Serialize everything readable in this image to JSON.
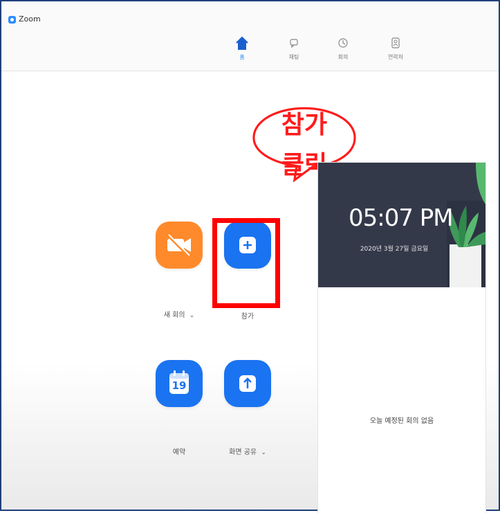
{
  "window": {
    "title": "Zoom"
  },
  "nav": {
    "tabs": [
      {
        "label": "홈",
        "icon": "home-icon",
        "active": true
      },
      {
        "label": "채팅",
        "icon": "chat-icon",
        "active": false
      },
      {
        "label": "회의",
        "icon": "clock-icon",
        "active": false
      },
      {
        "label": "연락처",
        "icon": "contacts-icon",
        "active": false
      }
    ]
  },
  "callout": {
    "line1": "참가",
    "line2": "클릭"
  },
  "actions": {
    "new_meeting": {
      "label": "새 회의",
      "chevron": "⌄",
      "icon": "video-off-icon",
      "color": "#ff8a2b"
    },
    "join": {
      "label": "참가",
      "icon": "plus-icon",
      "color": "#1a73f0"
    },
    "schedule": {
      "label": "예약",
      "icon": "calendar-icon",
      "calendar_day": "19",
      "color": "#1a73f0"
    },
    "share_screen": {
      "label": "화면 공유",
      "chevron": "⌄",
      "icon": "share-up-arrow-icon",
      "color": "#1a73f0"
    }
  },
  "schedule_panel": {
    "time": "05:07 PM",
    "date": "2020년 3월 27일 금요일",
    "empty_message": "오늘 예정된 회의 없음"
  },
  "colors": {
    "accent": "#2d8cff",
    "highlight": "#ff0000",
    "callout_text": "#ff1b1b",
    "clock_bg": "#34394a"
  }
}
